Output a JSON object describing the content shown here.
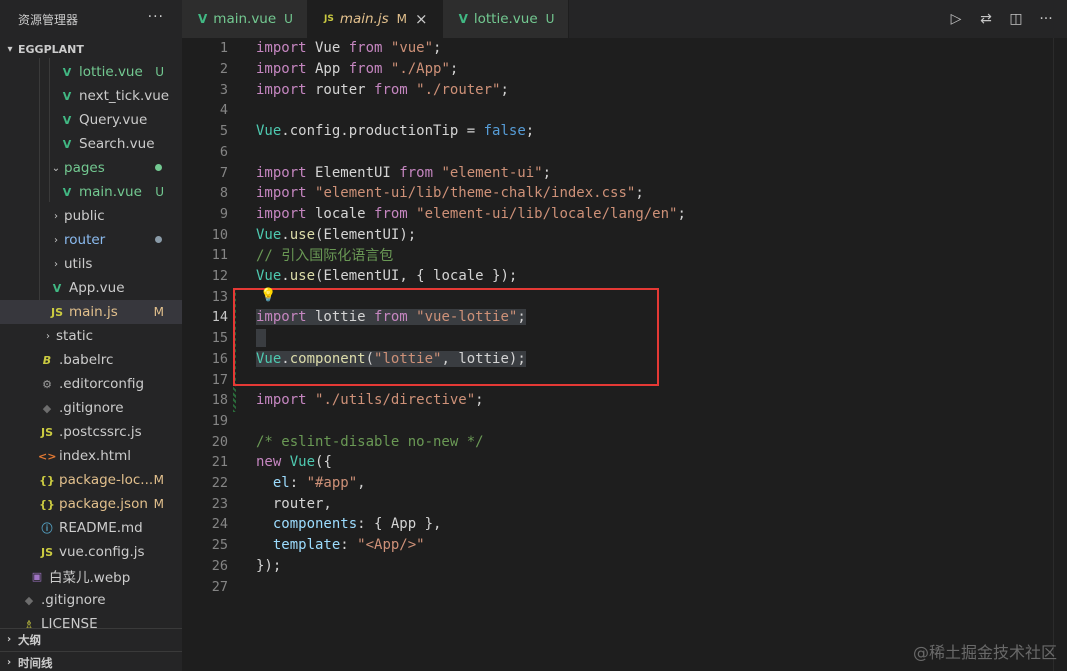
{
  "explorer": {
    "title": "资源管理器",
    "more": "···",
    "project": "EGGPLANT",
    "items": [
      {
        "name": "lottie.vue",
        "badge": "U"
      },
      {
        "name": "next_tick.vue",
        "badge": ""
      },
      {
        "name": "Query.vue",
        "badge": ""
      },
      {
        "name": "Search.vue",
        "badge": ""
      },
      {
        "name": "pages",
        "badge": ""
      },
      {
        "name": "main.vue",
        "badge": "U"
      },
      {
        "name": "public",
        "badge": ""
      },
      {
        "name": "router",
        "badge": ""
      },
      {
        "name": "utils",
        "badge": ""
      },
      {
        "name": "App.vue",
        "badge": ""
      },
      {
        "name": "main.js",
        "badge": "M"
      },
      {
        "name": "static",
        "badge": ""
      },
      {
        "name": ".babelrc",
        "badge": ""
      },
      {
        "name": ".editorconfig",
        "badge": ""
      },
      {
        "name": ".gitignore",
        "badge": ""
      },
      {
        "name": ".postcssrc.js",
        "badge": ""
      },
      {
        "name": "index.html",
        "badge": ""
      },
      {
        "name": "package-loc...",
        "badge": "M"
      },
      {
        "name": "package.json",
        "badge": "M"
      },
      {
        "name": "README.md",
        "badge": ""
      },
      {
        "name": "vue.config.js",
        "badge": ""
      },
      {
        "name": "白菜儿.webp",
        "badge": ""
      },
      {
        "name": ".gitignore",
        "badge": ""
      },
      {
        "name": "LICENSE",
        "badge": ""
      }
    ],
    "outline": "大纲",
    "timeline": "时间线"
  },
  "tabs": [
    {
      "label": "main.vue",
      "badge": "U",
      "icon": "V"
    },
    {
      "label": "main.js",
      "badge": "M",
      "icon": "JS"
    },
    {
      "label": "lottie.vue",
      "badge": "U",
      "icon": "V"
    }
  ],
  "tab_close": "×",
  "icons": {
    "run": "run-icon",
    "compare": "compare-changes-icon",
    "split": "split-editor-icon",
    "more": "more-actions-icon"
  },
  "colors": {
    "vue_green": "#41b883",
    "untracked": "#73c991",
    "modified": "#e2c08d",
    "highlight_box": "#e53935"
  },
  "code": {
    "l1": [
      "import",
      " Vue ",
      "from",
      " ",
      "\"vue\"",
      ";"
    ],
    "l2": [
      "import",
      " App ",
      "from",
      " ",
      "\"./App\"",
      ";"
    ],
    "l3": [
      "import",
      " router ",
      "from",
      " ",
      "\"./router\"",
      ";"
    ],
    "l5": [
      "Vue",
      ".config.productionTip ",
      "=",
      " ",
      "false",
      ";"
    ],
    "l7": [
      "import",
      " ElementUI ",
      "from",
      " ",
      "\"element-ui\"",
      ";"
    ],
    "l8": [
      "import",
      " ",
      "\"element-ui/lib/theme-chalk/index.css\"",
      ";"
    ],
    "l9": [
      "import",
      " locale ",
      "from",
      " ",
      "\"element-ui/lib/locale/lang/en\"",
      ";"
    ],
    "l10": [
      "Vue",
      ".",
      "use",
      "(ElementUI);"
    ],
    "l11": "// 引入国际化语言包",
    "l12": [
      "Vue",
      ".",
      "use",
      "(ElementUI, { locale });"
    ],
    "l14": [
      "import",
      " lottie ",
      "from",
      " ",
      "\"vue-lottie\"",
      ";"
    ],
    "l16": [
      "Vue",
      ".",
      "component",
      "(",
      "\"lottie\"",
      ", lottie);"
    ],
    "l18": [
      "import",
      " ",
      "\"./utils/directive\"",
      ";"
    ],
    "l20": "/* eslint-disable no-new */",
    "l21": [
      "new",
      " ",
      "Vue",
      "({"
    ],
    "l22": [
      "  el",
      ": ",
      "\"#app\"",
      ","
    ],
    "l23": "  router,",
    "l24": [
      "  components",
      ": { App },"
    ],
    "l25": [
      "  template",
      ": ",
      "\"<App/>\""
    ],
    "l26": "});"
  },
  "line_numbers": [
    "1",
    "2",
    "3",
    "4",
    "5",
    "6",
    "7",
    "8",
    "9",
    "10",
    "11",
    "12",
    "13",
    "14",
    "15",
    "16",
    "17",
    "18",
    "19",
    "20",
    "21",
    "22",
    "23",
    "24",
    "25",
    "26",
    "27"
  ],
  "watermark": "@稀土掘金技术社区"
}
